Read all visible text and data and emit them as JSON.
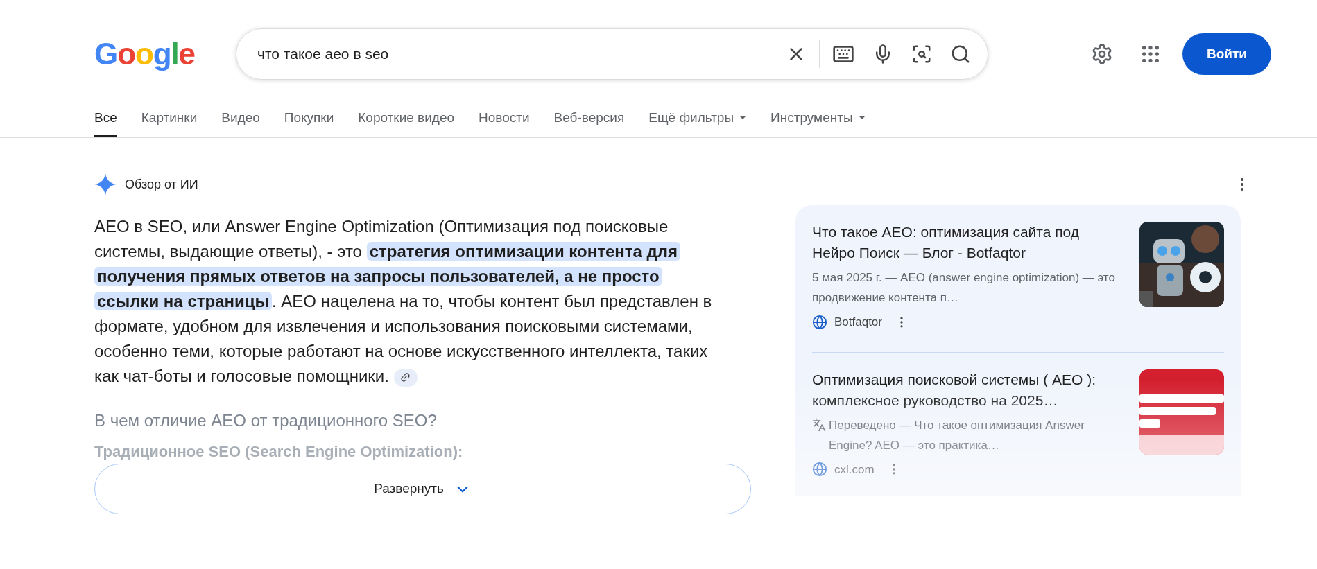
{
  "logo": {
    "text": "Google"
  },
  "search": {
    "value": "что такое aeo в seo"
  },
  "header": {
    "sign_in": "Войти"
  },
  "tabs": [
    {
      "label": "Все",
      "selected": true,
      "kind": "plain"
    },
    {
      "label": "Картинки",
      "selected": false,
      "kind": "plain"
    },
    {
      "label": "Видео",
      "selected": false,
      "kind": "plain"
    },
    {
      "label": "Покупки",
      "selected": false,
      "kind": "plain"
    },
    {
      "label": "Короткие видео",
      "selected": false,
      "kind": "plain"
    },
    {
      "label": "Новости",
      "selected": false,
      "kind": "plain"
    },
    {
      "label": "Веб-версия",
      "selected": false,
      "kind": "plain"
    },
    {
      "label": "Ещё фильтры",
      "selected": false,
      "kind": "dropdown"
    },
    {
      "label": "Инструменты",
      "selected": false,
      "kind": "dropdown"
    }
  ],
  "ai_overview": {
    "title": "Обзор от ИИ",
    "paragraph": [
      {
        "kind": "text",
        "text": "AEO в SEO, или "
      },
      {
        "kind": "link",
        "text": "Answer Engine Optimization"
      },
      {
        "kind": "text",
        "text": " (Оптимизация под поисковые системы, выдающие ответы), - это "
      },
      {
        "kind": "highlight",
        "text": "стратегия оптимизации контента для получения прямых ответов на запросы пользователей, а не просто ссылки на страницы"
      },
      {
        "kind": "text",
        "text": ". AEO нацелена на то, чтобы контент был представлен в формате, удобном для извлечения и использования поисковыми системами, особенно теми, которые работают на основе искусственного интеллекта, таких как чат-боты и голосовые помощники. "
      },
      {
        "kind": "citation"
      }
    ],
    "subheading": "В чем отличие AEO от традиционного SEO?",
    "faded_line": "Традиционное SEO (Search Engine Optimization):",
    "expand_button": "Развернуть"
  },
  "sources": [
    {
      "title": "Что такое AEO: оптимизация сайта под Нейро Поиск — Блог - Botfaqtor",
      "translated": false,
      "snippet": "5 мая 2025 г. — AEO (answer engine optimization) — это продвижение контента п…",
      "site": "Botfaqtor"
    },
    {
      "title": "Оптимизация поисковой системы ( AEO ): комплексное руководство на 2025…",
      "translated": true,
      "snippet": "Переведено — Что такое оптимизация Answer Engine? AEO — это практика…",
      "site": "cxl.com"
    }
  ]
}
